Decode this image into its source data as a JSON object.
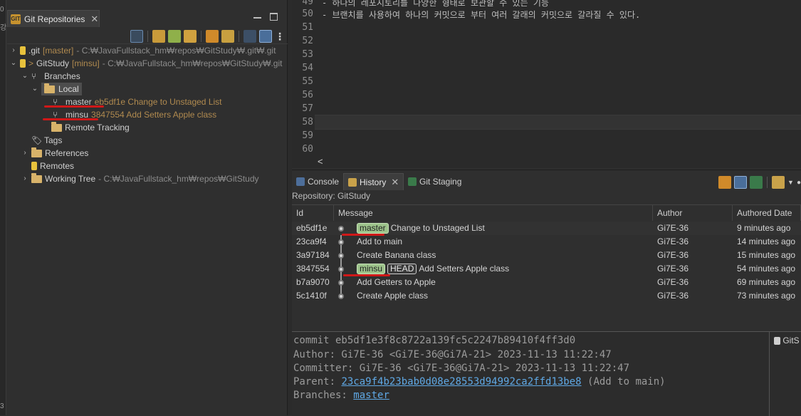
{
  "left_edge": {
    "top_char": "0",
    "mid_char": "강",
    "bottom_char": "3"
  },
  "repos_view": {
    "tab_title": "Git Repositories",
    "tree": {
      "repo1": {
        "name": ".git",
        "branch": "[master]",
        "path": "- C:₩JavaFullstack_hm₩repos₩GitStudy₩.git₩.git"
      },
      "repo2": {
        "prefix": ">",
        "name": "GitStudy",
        "branch": "[minsu]",
        "path": "- C:₩JavaFullstack_hm₩repos₩GitStudy₩.git"
      },
      "branches": "Branches",
      "local": "Local",
      "master_name": "master",
      "master_desc": "eb5df1e Change to Unstaged List",
      "minsu_name": "minsu",
      "minsu_desc": "3847554 Add Setters Apple class",
      "remote_tracking": "Remote Tracking",
      "tags": "Tags",
      "references": "References",
      "remotes": "Remotes",
      "working_tree": "Working Tree",
      "working_tree_path": "- C:₩JavaFullstack_hm₩repos₩GitStudy"
    }
  },
  "editor": {
    "lines": [
      {
        "num": "49",
        "text": "- 하나의 레포지토리를 다양한 형태로 보관할 수 있는 기능"
      },
      {
        "num": "50",
        "text": "- 브랜치를 사용하여 하나의 커밋으로 부터 여러 갈래의 커밋으로 갈라질 수 있다."
      },
      {
        "num": "51",
        "text": ""
      },
      {
        "num": "52",
        "text": ""
      },
      {
        "num": "53",
        "text": ""
      },
      {
        "num": "54",
        "text": ""
      },
      {
        "num": "55",
        "text": ""
      },
      {
        "num": "56",
        "text": ""
      },
      {
        "num": "57",
        "text": ""
      },
      {
        "num": "58",
        "text": ""
      },
      {
        "num": "59",
        "text": ""
      },
      {
        "num": "60",
        "text": ""
      }
    ],
    "scroll_left": "<"
  },
  "bottom": {
    "tabs": {
      "console": "Console",
      "history": "History",
      "staging": "Git Staging"
    },
    "repository_label": "Repository: GitStudy",
    "columns": {
      "id": "Id",
      "message": "Message",
      "author": "Author",
      "date": "Authored Date"
    },
    "commits": [
      {
        "id": "eb5df1e",
        "refs": [
          "master"
        ],
        "head": "",
        "message": "Change to Unstaged List",
        "author": "Gi7E-36",
        "date": "9 minutes ago"
      },
      {
        "id": "23ca9f4",
        "refs": [],
        "head": "",
        "message": "Add to main",
        "author": "Gi7E-36",
        "date": "14 minutes ago"
      },
      {
        "id": "3a97184",
        "refs": [],
        "head": "",
        "message": "Create Banana class",
        "author": "Gi7E-36",
        "date": "15 minutes ago"
      },
      {
        "id": "3847554",
        "refs": [
          "minsu"
        ],
        "head": "HEAD",
        "message": "Add Setters Apple class",
        "author": "Gi7E-36",
        "date": "54 minutes ago"
      },
      {
        "id": "b7a9070",
        "refs": [],
        "head": "",
        "message": "Add Getters to Apple",
        "author": "Gi7E-36",
        "date": "69 minutes ago"
      },
      {
        "id": "5c1410f",
        "refs": [],
        "head": "",
        "message": "Create Apple class",
        "author": "Gi7E-36",
        "date": "73 minutes ago"
      }
    ],
    "details": {
      "commit": "commit eb5df1e3f8c8722a139fc5c2247b89410f4ff3d0",
      "author": "Author: Gi7E-36 <Gi7E-36@Gi7A-21> 2023-11-13 11:22:47",
      "committer": "Committer: Gi7E-36 <Gi7E-36@Gi7A-21> 2023-11-13 11:22:47",
      "parent_label": "Parent: ",
      "parent_hash": "23ca9f4b23bab0d08e28553d94992ca2ffd13be8",
      "parent_note": " (Add to main)",
      "branches_label": "Branches: ",
      "branches_value": "master"
    },
    "right_mini": "GitS"
  },
  "colors": {
    "underline": "#d01818",
    "branch_tag": "#9dc38b",
    "link": "#5fa8e4",
    "desc_gold": "#b08a4f"
  }
}
